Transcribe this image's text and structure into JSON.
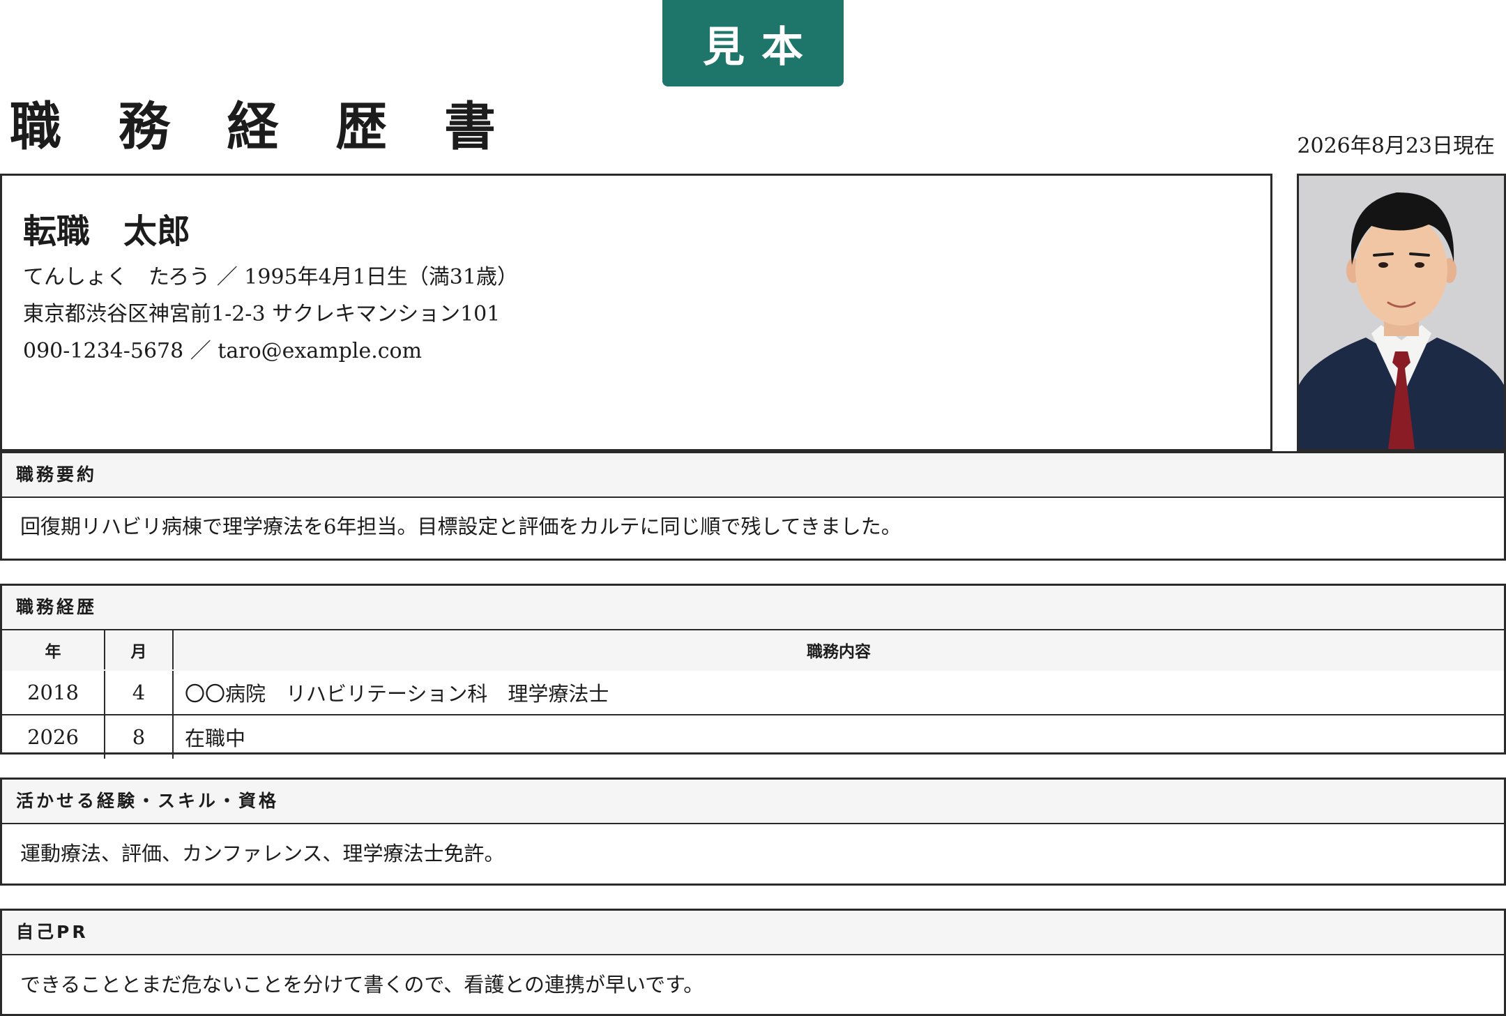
{
  "badge": "見本",
  "title": "職 務 経 歴 書",
  "date": "2026年8月23日現在",
  "profile": {
    "name": "転職　太郎",
    "kana_birth": "てんしょく　たろう ／ 1995年4月1日生（満31歳）",
    "address": "東京都渋谷区神宮前1-2-3 サクレキマンション101",
    "contact": "090-1234-5678 ／ taro@example.com"
  },
  "summary": {
    "heading": "職務要約",
    "text": "回復期リハビリ病棟で理学療法を6年担当。目標設定と評価をカルテに同じ順で残してきました。"
  },
  "history": {
    "heading": "職務経歴",
    "columns": [
      "年",
      "月",
      "職務内容"
    ],
    "rows": [
      {
        "year": "2018",
        "month": "4",
        "content": "〇〇病院　リハビリテーション科　理学療法士"
      },
      {
        "year": "2026",
        "month": "8",
        "content": "在職中"
      }
    ]
  },
  "skills": {
    "heading": "活かせる経験・スキル・資格",
    "text": "運動療法、評価、カンファレンス、理学療法士免許。"
  },
  "pr": {
    "heading": "自己PR",
    "text": "できることとまだ危ないことを分けて書くので、看護との連携が早いです。"
  }
}
